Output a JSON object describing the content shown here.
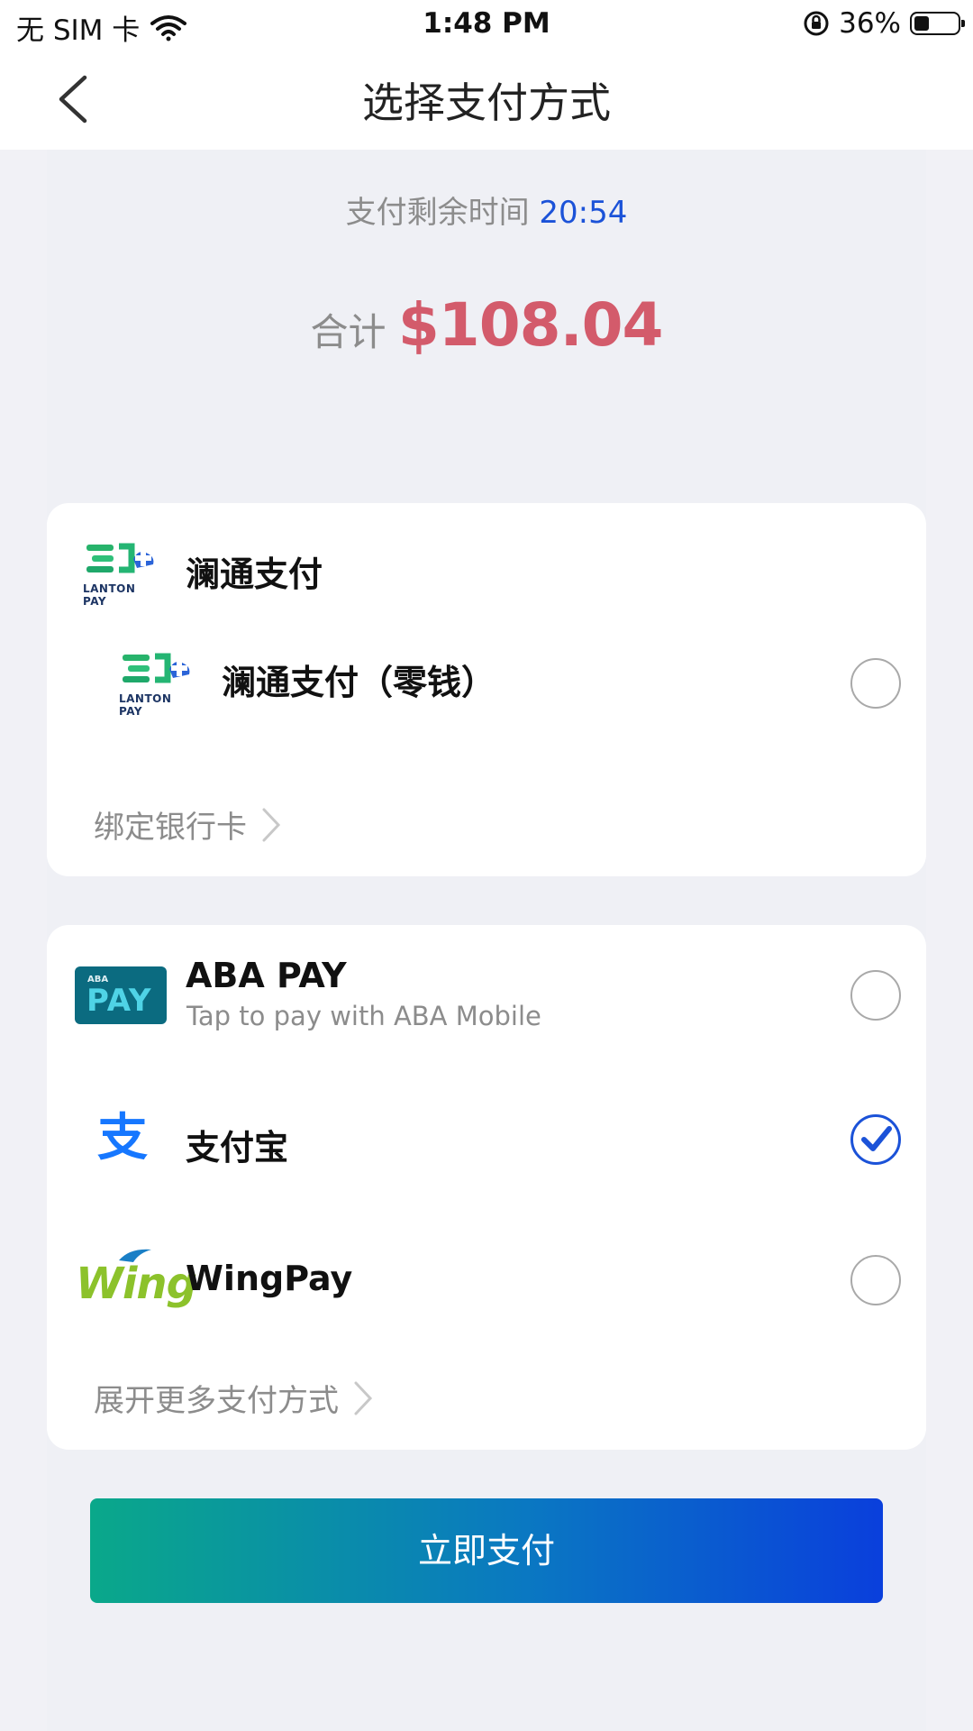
{
  "status": {
    "carrier": "无 SIM 卡",
    "time": "1:48 PM",
    "battery": "36%",
    "battery_level": 0.36
  },
  "nav": {
    "title": "选择支付方式"
  },
  "summary": {
    "timer_label": "支付剩余时间",
    "timer_value": "20:54",
    "total_label": "合计",
    "total_value": "$108.04"
  },
  "lanton": {
    "header": "澜通支付",
    "logo_text": "LANTON PAY",
    "option_label": "澜通支付（零钱）",
    "bind_link": "绑定银行卡"
  },
  "methods": [
    {
      "name": "ABA PAY",
      "subtitle": "Tap to pay with ABA Mobile",
      "logo_top": "ABA",
      "logo_main": "PAY",
      "selected": false
    },
    {
      "name": "支付宝",
      "logo_glyph": "支",
      "selected": true
    },
    {
      "name": "WingPay",
      "logo_text": "Wing",
      "selected": false
    }
  ],
  "more_link": "展开更多支付方式",
  "pay_button": "立即支付",
  "colors": {
    "accent_blue": "#1b52d8",
    "amount_red": "#d35b6b",
    "gradient_start": "#0aa88a",
    "gradient_end": "#0a3fdc"
  }
}
